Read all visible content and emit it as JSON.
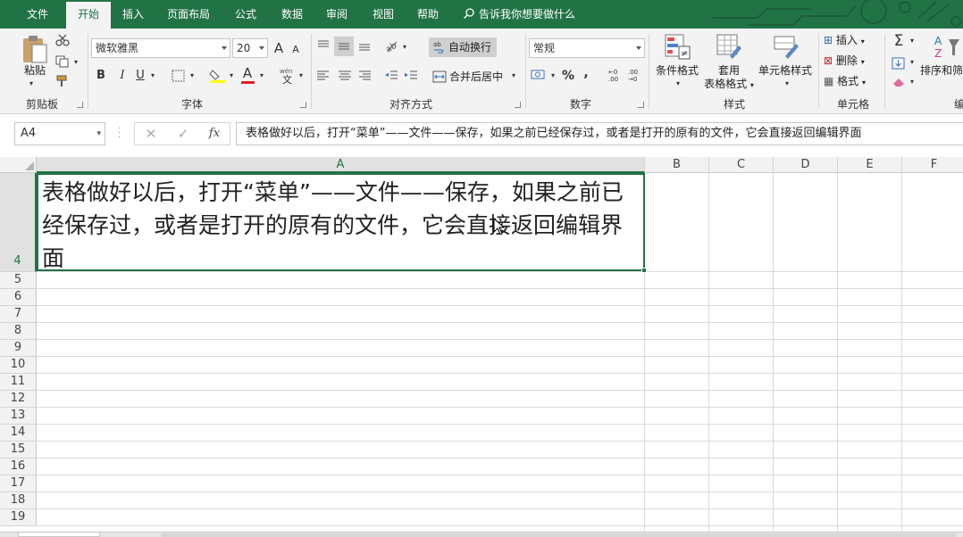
{
  "tabs": [
    {
      "label": "文件",
      "active": false
    },
    {
      "label": "开始",
      "active": true
    },
    {
      "label": "插入",
      "active": false
    },
    {
      "label": "页面布局",
      "active": false
    },
    {
      "label": "公式",
      "active": false
    },
    {
      "label": "数据",
      "active": false
    },
    {
      "label": "审阅",
      "active": false
    },
    {
      "label": "视图",
      "active": false
    },
    {
      "label": "帮助",
      "active": false
    }
  ],
  "tellme": "告诉我你想要做什么",
  "ribbon": {
    "clipboard": {
      "paste": "粘贴",
      "group": "剪贴板"
    },
    "font": {
      "name": "微软雅黑",
      "size": "20",
      "group": "字体",
      "bold": "B",
      "italic": "I",
      "underline": "U",
      "grow": "A",
      "shrink": "A",
      "color_letter": "A"
    },
    "align": {
      "wrap": "自动换行",
      "merge": "合并后居中",
      "group": "对齐方式"
    },
    "number": {
      "format": "常规",
      "group": "数字"
    },
    "styles": {
      "cond": "条件格式",
      "table_l1": "套用",
      "table_l2": "表格格式",
      "cell": "单元格样式",
      "group": "样式"
    },
    "cells": {
      "insert": "插入",
      "delete": "删除",
      "format": "格式",
      "group": "单元格"
    },
    "edit": {
      "sort": "排序和筛",
      "group": "编"
    }
  },
  "formula_bar": {
    "name_box": "A4",
    "content": "表格做好以后，打开“菜单”——文件——保存，如果之前已经保存过，或者是打开的原有的文件，它会直接返回编辑界面"
  },
  "columns": [
    "A",
    "B",
    "C",
    "D",
    "E",
    "F"
  ],
  "rows": [
    "4",
    "5",
    "6",
    "7",
    "8",
    "9",
    "10",
    "11",
    "12",
    "13",
    "14",
    "15",
    "16",
    "17",
    "18",
    "19"
  ],
  "cell_text": "表格做好以后，打开“菜单”——文件——保存，如果之前已经保存过，或者是打开的原有的文件，它会直接返回编辑界面",
  "colors": {
    "accent": "#217346"
  }
}
